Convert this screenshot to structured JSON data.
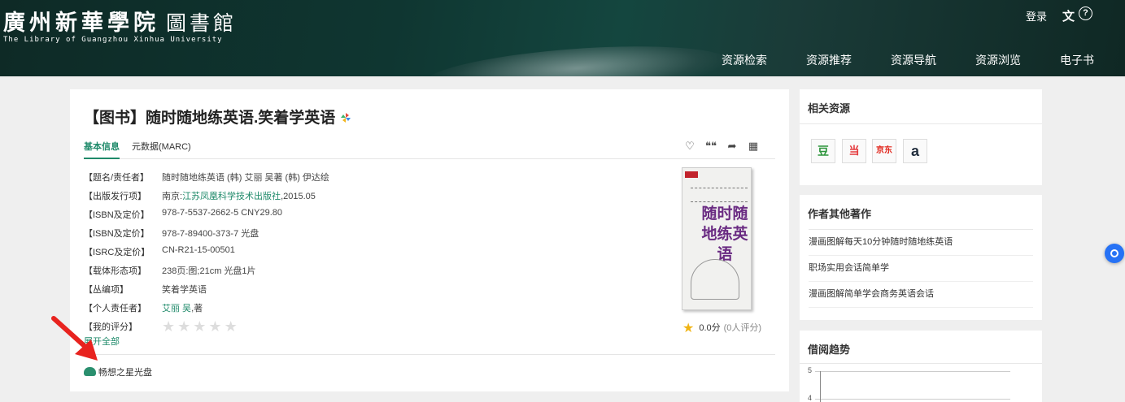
{
  "header": {
    "logo_cn": "廣州新華學院",
    "logo_lib": "圖書館",
    "logo_en": "The Library of Guangzhou Xinhua University",
    "login": "登录",
    "lang_icon": "文",
    "help_icon": "?",
    "nav": [
      "资源检索",
      "资源推荐",
      "资源导航",
      "资源浏览",
      "电子书"
    ]
  },
  "book": {
    "title": "【图书】随时随地练英语.笑着学英语",
    "tabs": [
      "基本信息",
      "元数据(MARC)"
    ],
    "tab_icons": [
      "♡",
      "❝❝",
      "➦",
      "▦"
    ],
    "fields": [
      {
        "label": "【题名/责任者】",
        "value": "随时随地练英语 (韩) 艾丽 吴著 (韩) 伊达绘"
      },
      {
        "label": "【出版发行项】",
        "value_pre": "南京:",
        "value_link": "江苏凤凰科学技术出版社",
        "value_post": ",2015.05"
      },
      {
        "label": "【ISBN及定价】",
        "value": "978-7-5537-2662-5 CNY29.80"
      },
      {
        "label": "【ISBN及定价】",
        "value": "978-7-89400-373-7 光盘"
      },
      {
        "label": "【ISRC及定价】",
        "value": "CN-R21-15-00501"
      },
      {
        "label": "【载体形态项】",
        "value": "238页:图;21cm 光盘1片"
      },
      {
        "label": "【丛编项】",
        "value_link": "笑着学英语"
      },
      {
        "label": "【个人责任者】",
        "value_link": "艾丽 吴",
        "value_post": ",著"
      },
      {
        "label": "【我的评分】"
      }
    ],
    "rating_stars": 0,
    "expand": "展开全部",
    "cd_resource": "畅想之星光盘",
    "cover_title": "随时随地练英语",
    "score": "0.0分",
    "score_count": "(0人评分)"
  },
  "side": {
    "related_title": "相关资源",
    "related_icons": [
      {
        "name": "douban-icon",
        "glyph": "豆",
        "color": "#2e963d"
      },
      {
        "name": "dangdang-icon",
        "glyph": "当",
        "color": "#e4393c"
      },
      {
        "name": "jd-icon",
        "glyph": "京东",
        "color": "#e1251b"
      },
      {
        "name": "amazon-icon",
        "glyph": "a",
        "color": "#232f3e"
      }
    ],
    "works_title": "作者其他著作",
    "works": [
      "漫画图解每天10分钟随时随地练英语",
      "职场实用会话简单学",
      "漫画图解简单学会商务英语会话"
    ],
    "trend_title": "借阅趋势",
    "trend_ticks": [
      "5",
      "4"
    ]
  },
  "colors": {
    "accent": "#1f8a6a",
    "header_bg": "#0f3631",
    "float_button": "#2672f5"
  }
}
